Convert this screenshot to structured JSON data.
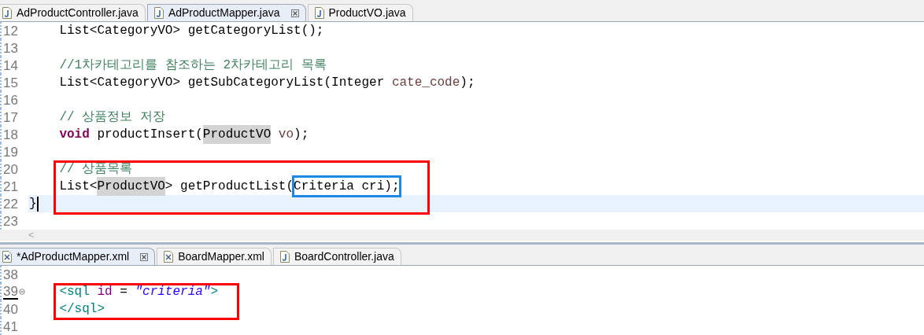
{
  "editors": [
    {
      "tabs": [
        {
          "label": "AdProductController.java",
          "kind": "java",
          "selected": false,
          "closable": false
        },
        {
          "label": "AdProductMapper.java",
          "kind": "java",
          "selected": true,
          "closable": true
        },
        {
          "label": "ProductVO.java",
          "kind": "java",
          "selected": false,
          "closable": false
        }
      ],
      "lines": [
        {
          "number": "12",
          "current": false,
          "framed": false,
          "foldable": false,
          "tokens": [
            {
              "kind": "plain",
              "text": "    List<CategoryVO> getCategoryList();"
            }
          ]
        },
        {
          "number": "13",
          "current": false,
          "framed": false,
          "foldable": false
        },
        {
          "number": "14",
          "current": false,
          "framed": false,
          "foldable": false,
          "tokens": [
            {
              "kind": "comment",
              "text": "    //1차카테고리를 참조하는 2차카테고리 목록"
            }
          ]
        },
        {
          "number": "15",
          "current": false,
          "framed": false,
          "foldable": false,
          "tokens": [
            {
              "kind": "plain",
              "text": "    List<CategoryVO> getSubCategoryList(Integer "
            },
            {
              "kind": "param",
              "text": "cate_code"
            },
            {
              "kind": "plain",
              "text": ");"
            }
          ]
        },
        {
          "number": "16",
          "current": false,
          "framed": false,
          "foldable": false
        },
        {
          "number": "17",
          "current": false,
          "framed": false,
          "foldable": false,
          "tokens": [
            {
              "kind": "comment",
              "text": "    // 상품정보 저장"
            }
          ]
        },
        {
          "number": "18",
          "current": false,
          "framed": false,
          "foldable": false,
          "tokens": [
            {
              "kind": "keyword",
              "text": "    void"
            },
            {
              "kind": "plain",
              "text": " productInsert("
            },
            {
              "kind": "occurrence",
              "text": "ProductVO"
            },
            {
              "kind": "param",
              "text": " vo"
            },
            {
              "kind": "plain",
              "text": ");"
            }
          ]
        },
        {
          "number": "19",
          "current": false,
          "framed": false,
          "foldable": false
        },
        {
          "number": "20",
          "current": false,
          "framed": true,
          "foldable": false,
          "tokens": [
            {
              "kind": "comment",
              "text": "    // 상품목록"
            }
          ]
        },
        {
          "number": "21",
          "current": false,
          "framed": true,
          "foldable": false,
          "tokens": [
            {
              "kind": "plain",
              "text": "    List<"
            },
            {
              "kind": "occurrence",
              "text": "ProductVO"
            },
            {
              "kind": "plain",
              "text": "> getProductList("
            },
            {
              "kind": "boxed",
              "text": "Criteria cri);"
            }
          ]
        },
        {
          "number": "22",
          "current": true,
          "framed": true,
          "foldable": false,
          "tokens": [
            {
              "kind": "plain",
              "text": "}"
            }
          ]
        },
        {
          "number": "23",
          "current": false,
          "framed": false,
          "foldable": false
        }
      ],
      "scroll_arrow": "<"
    },
    {
      "tabs": [
        {
          "label": "*AdProductMapper.xml",
          "kind": "xml",
          "selected": true,
          "closable": true
        },
        {
          "label": "BoardMapper.xml",
          "kind": "xml",
          "selected": false,
          "closable": false
        },
        {
          "label": "BoardController.java",
          "kind": "java",
          "selected": false,
          "closable": false
        }
      ],
      "lines": [
        {
          "number": "38",
          "current": false,
          "framed": false,
          "foldable": false
        },
        {
          "number": "39",
          "current": false,
          "framed": true,
          "foldable": true,
          "tokens": [
            {
              "kind": "tag",
              "text": "    <sql"
            },
            {
              "kind": "attr",
              "text": " id"
            },
            {
              "kind": "plain",
              "text": " = "
            },
            {
              "kind": "string",
              "text": "\"criteria\""
            },
            {
              "kind": "tag",
              "text": ">"
            }
          ]
        },
        {
          "number": "40",
          "current": false,
          "framed": true,
          "foldable": false,
          "tokens": [
            {
              "kind": "tag",
              "text": "    </sql>"
            }
          ]
        },
        {
          "number": "41",
          "current": false,
          "framed": false,
          "foldable": false
        }
      ]
    }
  ]
}
